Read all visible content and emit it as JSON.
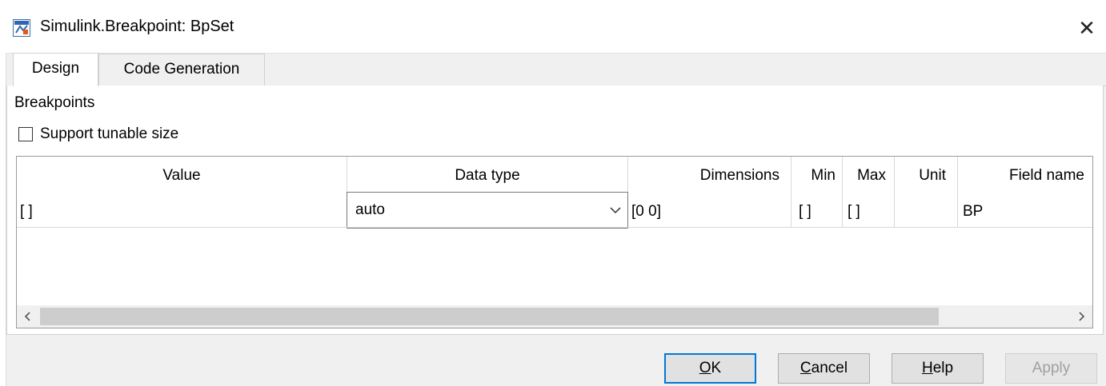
{
  "window": {
    "title": "Simulink.Breakpoint: BpSet",
    "close_label": "✕",
    "icon": "simulink-icon"
  },
  "tabs": [
    {
      "label": "Design",
      "active": true
    },
    {
      "label": "Code Generation",
      "active": false
    }
  ],
  "section": {
    "title": "Breakpoints",
    "checkbox_label": "Support tunable size",
    "checkbox_checked": false
  },
  "table": {
    "columns": [
      "Value",
      "Data type",
      "Dimensions",
      "Min",
      "Max",
      "Unit",
      "Field name"
    ],
    "rows": [
      {
        "value": "[ ]",
        "data_type": "auto",
        "dimensions": "[0 0]",
        "min": "[ ]",
        "max": "[ ]",
        "unit": "",
        "field_name": "BP"
      }
    ]
  },
  "buttons": {
    "ok": {
      "mnemonic": "O",
      "rest": "K"
    },
    "cancel": {
      "mnemonic": "C",
      "rest": "ancel"
    },
    "help": {
      "mnemonic": "H",
      "rest": "elp"
    },
    "apply": {
      "label": "Apply",
      "enabled": false
    }
  },
  "colors": {
    "focus_border": "#0078d7",
    "disabled_text": "#a0a0a0"
  }
}
